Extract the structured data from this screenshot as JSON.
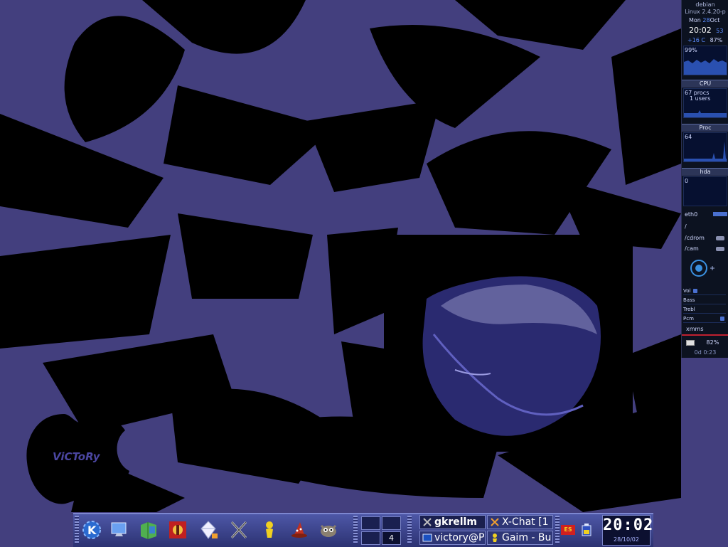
{
  "desktop": {
    "logo_text": "ViCToRy"
  },
  "gkrellm": {
    "hostname": "debian",
    "kernel": "Linux 2.4.20-p",
    "date_day": "Mon",
    "date_num": "28",
    "date_month": "Oct",
    "time": "20:02",
    "seconds": "53",
    "temperature": "+16 C",
    "humidity": "87%",
    "cpu_percent": "99%",
    "cpu_label": "CPU",
    "procs": "67 procs",
    "users": "1 users",
    "proc_label": "Proc",
    "proc_value": "64",
    "hda_label": "hda",
    "hda_value": "0",
    "net_label": "eth0",
    "fs_root": "/",
    "fs_cdrom": "/cdrom",
    "fs_cam": "/cam",
    "vol_controls": [
      "Vol",
      "Bass",
      "Trebl",
      "Pcm"
    ],
    "xmms_label": "xmms",
    "battery": "82%",
    "uptime": "0d 0:23"
  },
  "panel": {
    "launchers": [
      "kde-menu-icon",
      "monitor-icon",
      "file-manager-icon",
      "settings-icon",
      "crystal-icon",
      "x-icon",
      "aim-person-icon",
      "wizard-hat-icon",
      "gimp-icon"
    ],
    "pager_desktops": [
      "1",
      "2",
      "3",
      "4"
    ],
    "current_desktop": "4",
    "tasks": [
      {
        "title": "gkrellm"
      },
      {
        "title": "X-Chat [1"
      },
      {
        "title": "victory@P"
      },
      {
        "title": "Gaim - Bu"
      }
    ],
    "tray_flag": "ES",
    "clock_time": "20:02",
    "clock_date": "28/10/02"
  }
}
